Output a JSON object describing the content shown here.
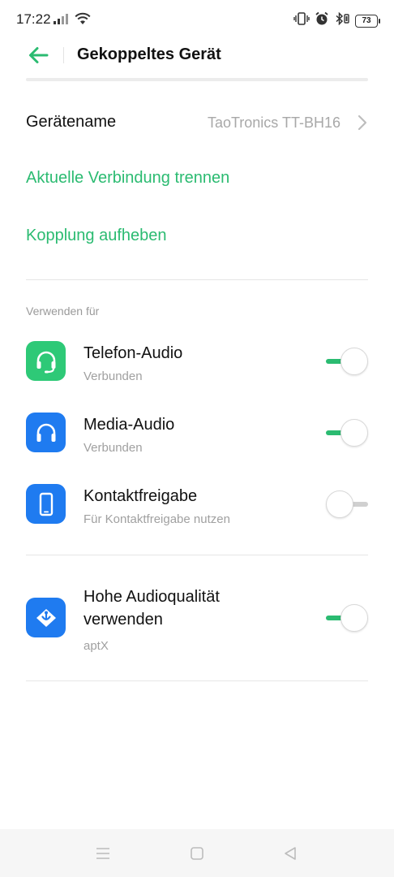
{
  "status_bar": {
    "time": "17:22",
    "battery": "73",
    "icons": [
      "signal-icon",
      "wifi-icon",
      "vibrate-icon",
      "alarm-icon",
      "bluetooth-icon",
      "battery-icon"
    ]
  },
  "header": {
    "title": "Gekoppeltes Gerät"
  },
  "device": {
    "name_label": "Gerätename",
    "name_value": "TaoTronics TT-BH16"
  },
  "actions": {
    "disconnect": "Aktuelle Verbindung trennen",
    "unpair": "Kopplung aufheben"
  },
  "section": {
    "use_for": "Verwenden für"
  },
  "profiles": [
    {
      "title": "Telefon-Audio",
      "subtitle": "Verbunden",
      "enabled": true,
      "icon": "headset-icon",
      "color": "#2ec977"
    },
    {
      "title": "Media-Audio",
      "subtitle": "Verbunden",
      "enabled": true,
      "icon": "headphones-icon",
      "color": "#1f7bf0"
    },
    {
      "title": "Kontaktfreigabe",
      "subtitle": "Für Kontaktfreigabe nutzen",
      "enabled": false,
      "icon": "phone-icon",
      "color": "#1f7bf0"
    }
  ],
  "hq_audio": {
    "title_line1": "Hohe Audioqualität",
    "title_line2": "verwenden",
    "subtitle": "aptX",
    "enabled": true,
    "icon": "aptx-icon",
    "color": "#1f7bf0"
  },
  "colors": {
    "accent": "#2bbb71",
    "secondary_text": "#a0a0a0"
  },
  "navbar": {
    "icons": [
      "menu-icon",
      "home-icon",
      "back-triangle-icon"
    ]
  }
}
